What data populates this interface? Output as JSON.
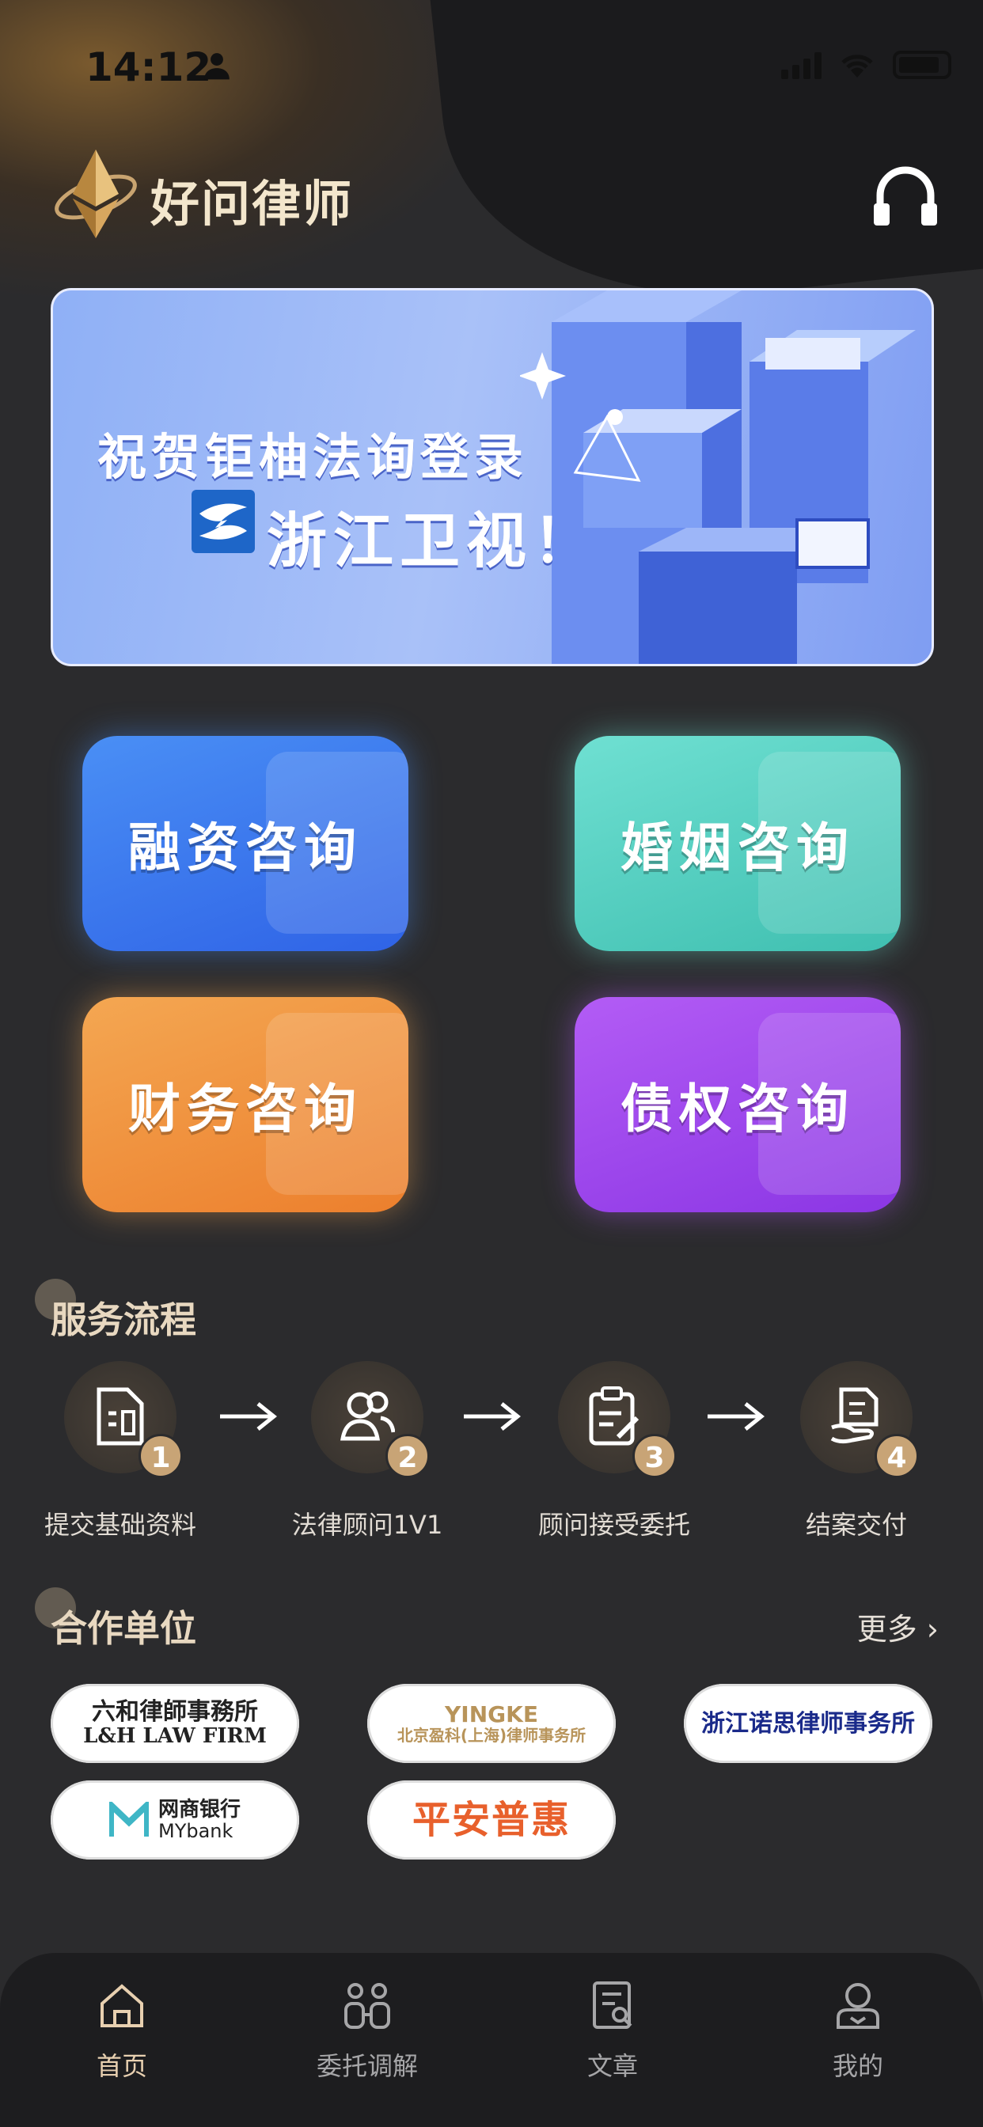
{
  "status_bar": {
    "time": "14:12"
  },
  "header": {
    "app_title": "好问律师"
  },
  "banner": {
    "line1": "祝贺钜柚法询登录",
    "line2": "浙江卫视！"
  },
  "services": [
    {
      "label": "融资咨询",
      "color": "#3b7af0"
    },
    {
      "label": "婚姻咨询",
      "color": "#52cfc0"
    },
    {
      "label": "财务咨询",
      "color": "#f0913f"
    },
    {
      "label": "债权咨询",
      "color": "#9f48ee"
    }
  ],
  "process": {
    "title": "服务流程",
    "steps": [
      {
        "num": "1",
        "label": "提交基础资料",
        "icon": "document-icon"
      },
      {
        "num": "2",
        "label": "法律顾问1V1",
        "icon": "users-icon"
      },
      {
        "num": "3",
        "label": "顾问接受委托",
        "icon": "clipboard-edit-icon"
      },
      {
        "num": "4",
        "label": "结案交付",
        "icon": "hand-document-icon"
      }
    ]
  },
  "partners": {
    "title": "合作单位",
    "more": "更多 ›",
    "items": [
      {
        "line1": "六和律師事務所",
        "line2": "L&H LAW FIRM"
      },
      {
        "line1": "YINGKE",
        "line2": "北京盈科(上海)律师事务所"
      },
      {
        "line1": "浙江诺思律师事务所",
        "line2": ""
      },
      {
        "line1": "网商银行",
        "line2": "MYbank"
      },
      {
        "line1": "平安普惠",
        "line2": ""
      }
    ]
  },
  "tabbar": {
    "items": [
      {
        "label": "首页",
        "icon": "home-icon",
        "active": true
      },
      {
        "label": "委托调解",
        "icon": "mediation-icon",
        "active": false
      },
      {
        "label": "文章",
        "icon": "article-icon",
        "active": false
      },
      {
        "label": "我的",
        "icon": "profile-icon",
        "active": false
      }
    ]
  },
  "colors": {
    "accent": "#c8a476",
    "background": "#2b2b2d"
  }
}
